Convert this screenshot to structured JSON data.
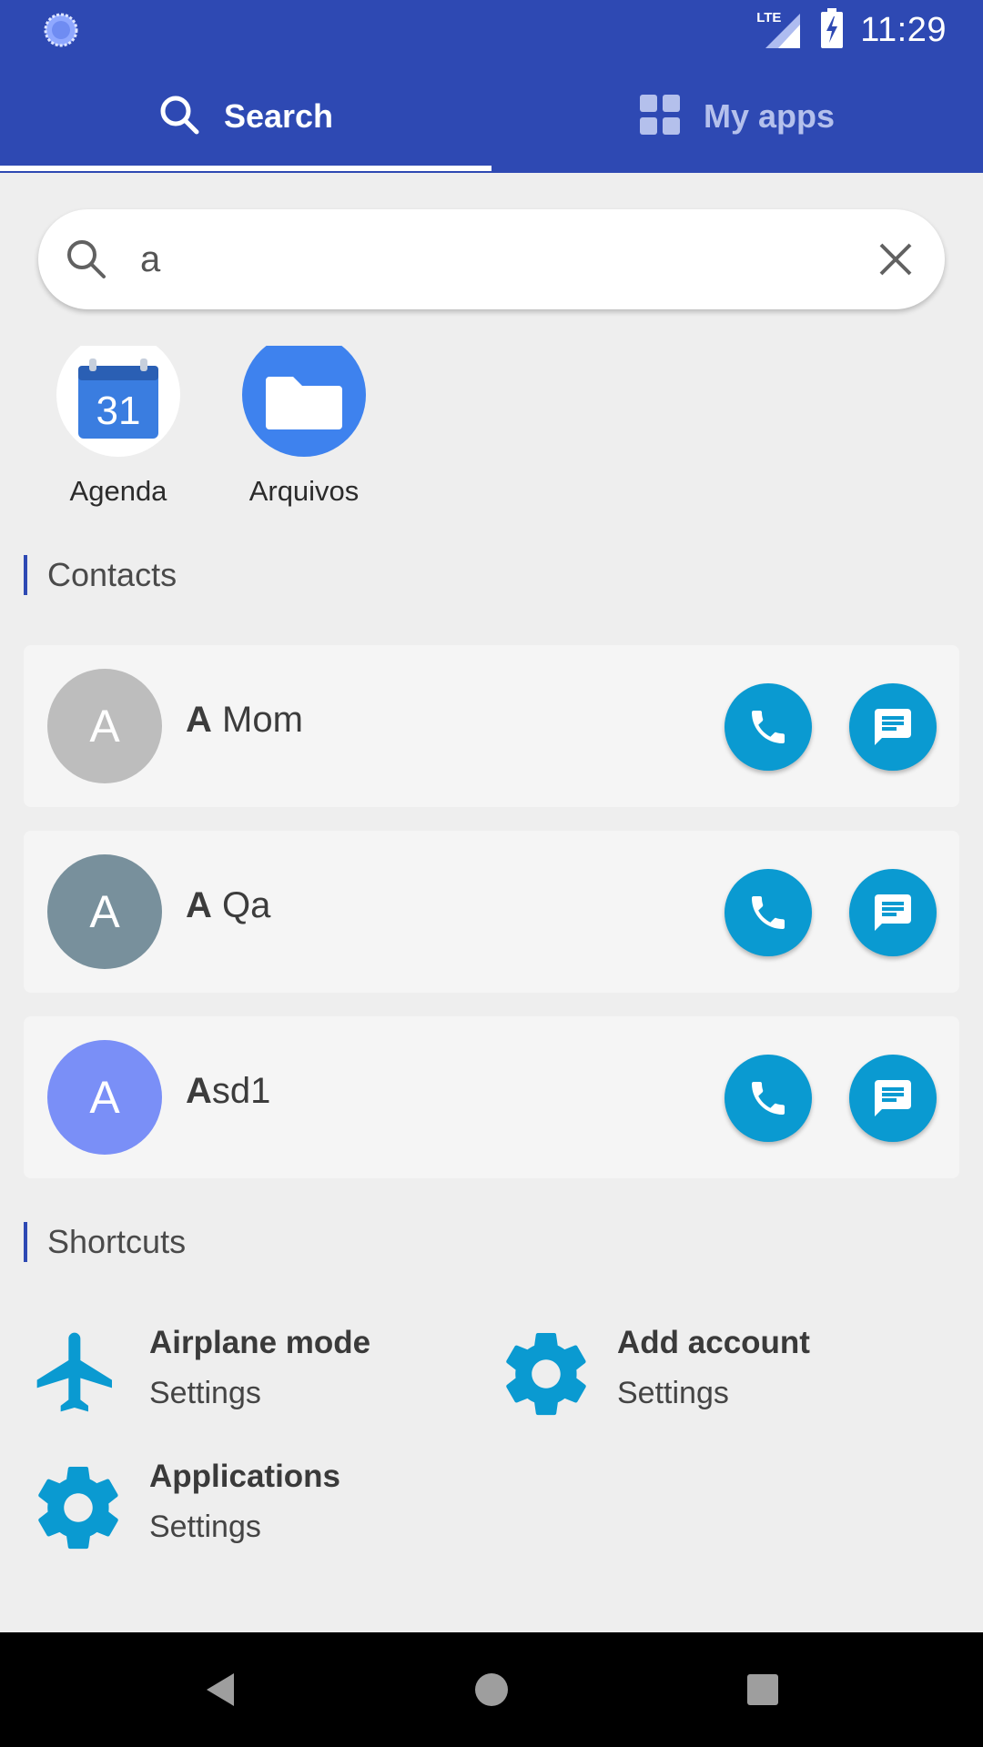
{
  "status_bar": {
    "time": "11:29",
    "network_label": "LTE"
  },
  "tabs": [
    {
      "label": "Search",
      "icon": "search-icon",
      "active": true
    },
    {
      "label": "My apps",
      "icon": "grid-icon",
      "active": false
    }
  ],
  "search": {
    "value": "a",
    "placeholder": ""
  },
  "apps": [
    {
      "label": "Agenda",
      "icon": "calendar-icon",
      "icon_text": "31"
    },
    {
      "label": "Arquivos",
      "icon": "folder-icon"
    }
  ],
  "contacts_section": {
    "title": "Contacts"
  },
  "contacts": [
    {
      "initial": "A",
      "name_bold": "A",
      "name_rest": " Mom",
      "avatar_color": "#bdbdbd"
    },
    {
      "initial": "A",
      "name_bold": "A",
      "name_rest": " Qa",
      "avatar_color": "#78909c"
    },
    {
      "initial": "A",
      "name_bold": "A",
      "name_rest": "sd1",
      "avatar_color": "#7a8ff7"
    }
  ],
  "shortcuts_section": {
    "title": "Shortcuts"
  },
  "shortcuts": [
    {
      "title": "Airplane mode",
      "subtitle": "Settings",
      "icon": "airplane-icon"
    },
    {
      "title": "Add account",
      "subtitle": "Settings",
      "icon": "gear-icon"
    },
    {
      "title": "Applications",
      "subtitle": "Settings",
      "icon": "gear-icon"
    }
  ],
  "colors": {
    "primary": "#2e49b3",
    "accent": "#0a9ad1",
    "background": "#eeeeee"
  }
}
